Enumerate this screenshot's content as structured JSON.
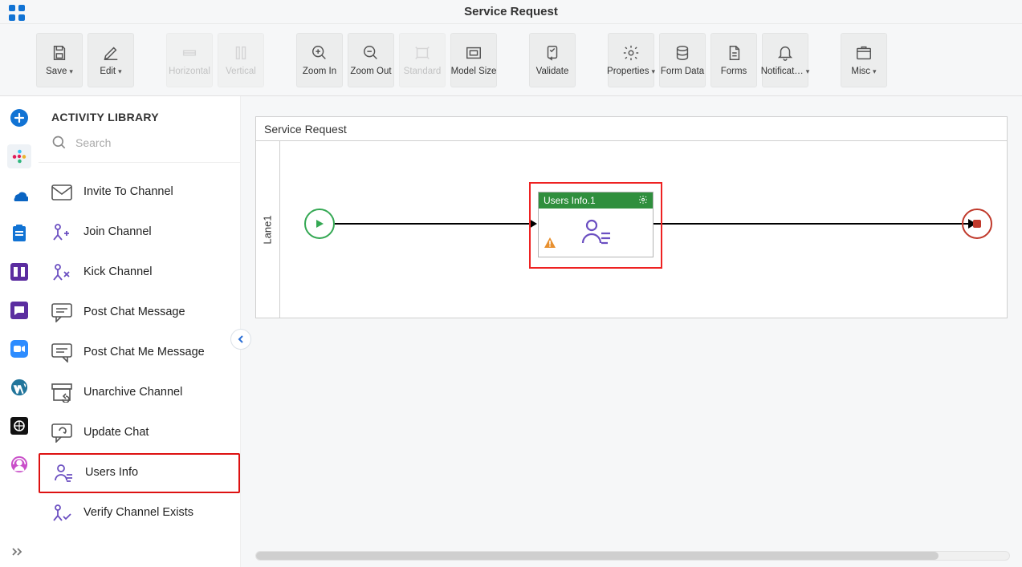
{
  "header": {
    "title": "Service Request"
  },
  "toolbar": {
    "save": "Save",
    "edit": "Edit",
    "horizontal": "Horizontal",
    "vertical": "Vertical",
    "zoomIn": "Zoom In",
    "zoomOut": "Zoom Out",
    "standard": "Standard",
    "modelSize": "Model Size",
    "validate": "Validate",
    "properties": "Properties",
    "formData": "Form Data",
    "forms": "Forms",
    "notifications": "Notificat…",
    "misc": "Misc"
  },
  "sidebar": {
    "title": "ACTIVITY LIBRARY",
    "searchPlaceholder": "Search",
    "items": [
      {
        "label": "Invite To Channel"
      },
      {
        "label": "Join Channel"
      },
      {
        "label": "Kick Channel"
      },
      {
        "label": "Post Chat Message"
      },
      {
        "label": "Post Chat Me Message"
      },
      {
        "label": "Unarchive Channel"
      },
      {
        "label": "Update Chat"
      },
      {
        "label": "Users Info"
      },
      {
        "label": "Verify Channel Exists"
      }
    ]
  },
  "canvas": {
    "poolTitle": "Service Request",
    "laneLabel": "Lane1",
    "activity": {
      "title": "Users Info.1"
    }
  },
  "icons": {
    "appGrid": "app-grid",
    "plus": "plus-circle",
    "slack": "slack",
    "onedrive": "onedrive",
    "clipboard": "clipboard",
    "columns": "columns",
    "chat": "chat",
    "zoom": "zoom-app",
    "wordpress": "wordpress",
    "grid": "grid-square",
    "support": "support-agent"
  }
}
